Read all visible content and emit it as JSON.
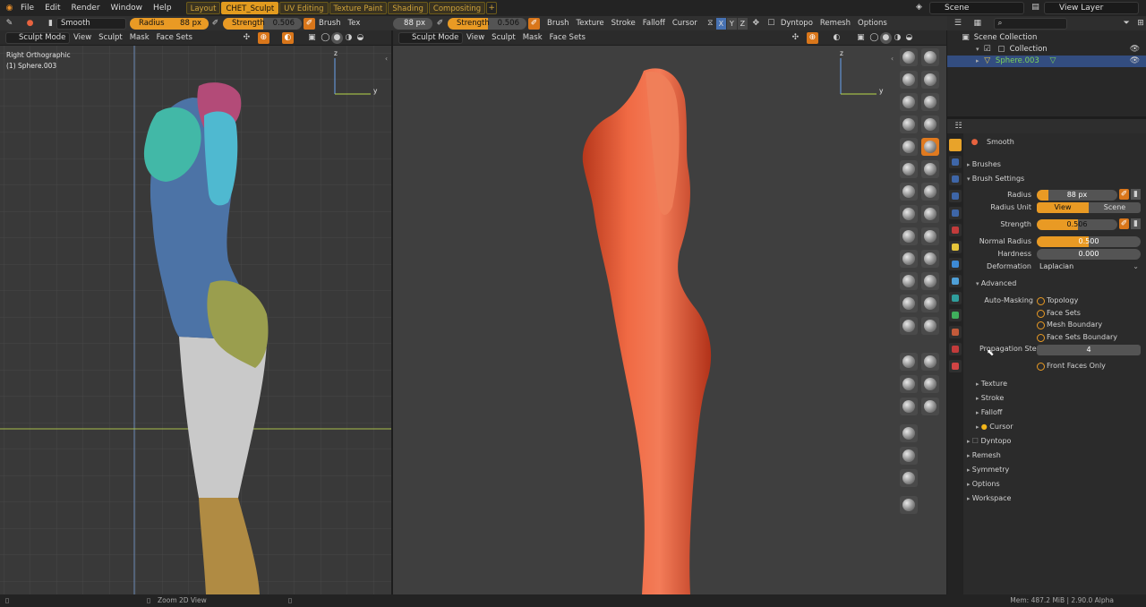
{
  "menu": {
    "items": [
      "File",
      "Edit",
      "Render",
      "Window",
      "Help"
    ]
  },
  "workspaces": [
    {
      "label": "Layout",
      "active": false
    },
    {
      "label": "CHET_Sculpt",
      "active": true
    },
    {
      "label": "UV Editing",
      "active": false
    },
    {
      "label": "Texture Paint",
      "active": false
    },
    {
      "label": "Shading",
      "active": false
    },
    {
      "label": "Compositing",
      "active": false
    }
  ],
  "scene": {
    "name": "Scene",
    "view_layer": "View Layer"
  },
  "left_tool_header": {
    "brush_name": "Smooth",
    "radius_label": "Radius",
    "radius_value": "88 px",
    "strength_label": "Strength",
    "strength_value": "0.506",
    "strength_fraction": 0.506,
    "brush_label": "Brush",
    "tex_label": "Tex"
  },
  "right_tool_header": {
    "radius_value": "88 px",
    "strength_label": "Strength",
    "strength_value": "0.506",
    "menus": [
      "Brush",
      "Texture",
      "Stroke",
      "Falloff",
      "Cursor"
    ],
    "symmetry_axes": [
      "X",
      "Y",
      "Z"
    ],
    "dyntopo_label": "Dyntopo",
    "remesh_label": "Remesh",
    "options_label": "Options"
  },
  "left_viewport": {
    "mode": "Sculpt Mode",
    "menus": [
      "View",
      "Sculpt",
      "Mask",
      "Face Sets"
    ],
    "view_name": "Right Orthographic",
    "object_name": "(1) Sphere.003",
    "axis_z": "z",
    "axis_y": "y"
  },
  "right_viewport": {
    "mode": "Sculpt Mode",
    "menus": [
      "View",
      "Sculpt",
      "Mask",
      "Face Sets"
    ],
    "axis_z": "z",
    "axis_y": "y"
  },
  "outliner": {
    "root": "Scene Collection",
    "collection": "Collection",
    "object": "Sphere.003",
    "object_color": "#7dd35a"
  },
  "properties": {
    "brush_name": "Smooth",
    "panel_brushes": "Brushes",
    "panel_brush_settings": "Brush Settings",
    "radius_label": "Radius",
    "radius_value": "88 px",
    "radius_unit_label": "Radius Unit",
    "radius_unit_view": "View",
    "radius_unit_scene": "Scene",
    "strength_label": "Strength",
    "strength_value": "0.506",
    "strength_fraction": 0.506,
    "normal_radius_label": "Normal Radius",
    "normal_radius_value": "0.500",
    "normal_radius_fraction": 0.5,
    "hardness_label": "Hardness",
    "hardness_value": "0.000",
    "deformation_label": "Deformation",
    "deformation_value": "Laplacian",
    "advanced_label": "Advanced",
    "auto_masking_label": "Auto-Masking",
    "auto_masking_options": [
      "Topology",
      "Face Sets",
      "Mesh Boundary",
      "Face Sets Boundary"
    ],
    "propagation_label": "Propagation Steps",
    "propagation_value": "4",
    "front_faces_label": "Front Faces Only",
    "subpanels": [
      "Texture",
      "Stroke",
      "Falloff",
      "Cursor"
    ],
    "panels": [
      "Dyntopo",
      "Remesh",
      "Symmetry",
      "Options",
      "Workspace"
    ]
  },
  "status": {
    "hint": "Zoom 2D View",
    "memory": "Mem: 487.2 MiB | 2.90.0 Alpha"
  },
  "colors": {
    "accent": "#e99a24",
    "selection": "#334d80",
    "clay": "#e8633f"
  }
}
